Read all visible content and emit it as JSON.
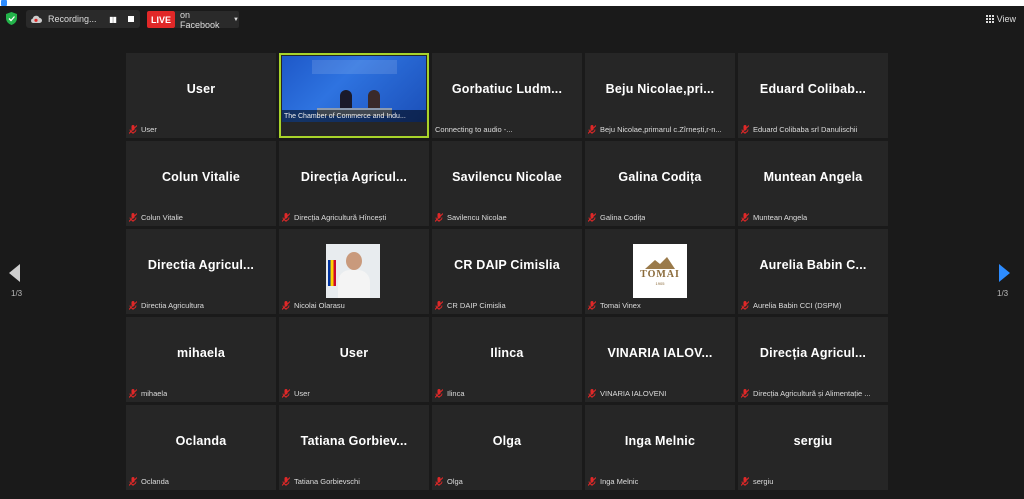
{
  "toolbar": {
    "recording_label": "Recording...",
    "live_label": "LIVE",
    "live_target": "on Facebook",
    "view_label": "View"
  },
  "pagination": {
    "left": "1/3",
    "right": "1/3"
  },
  "colors": {
    "live": "#e02828",
    "active_border": "#a8d42a",
    "accent": "#2d8cff"
  },
  "tiles": [
    {
      "name": "User",
      "label": "User"
    },
    {
      "name": "",
      "label": "",
      "caption": "The Chamber of Commerce and Indu..."
    },
    {
      "name": "Gorbatiuc Ludm...",
      "label": "Connecting to audio -..."
    },
    {
      "name": "Beju Nicolae,pri...",
      "label": "Beju Nicolae,primarul c.Zîrnești,r-n..."
    },
    {
      "name": "Eduard Colibab...",
      "label": "Eduard Colibaba srl Danulischii"
    },
    {
      "name": "Colun Vitalie",
      "label": "Colun Vitalie"
    },
    {
      "name": "Direcția Agricul...",
      "label": "Direcția Agricultură Hîncești"
    },
    {
      "name": "Savilencu Nicolae",
      "label": "Savilencu Nicolae"
    },
    {
      "name": "Galina Codița",
      "label": "Galina Codița"
    },
    {
      "name": "Muntean Angela",
      "label": "Muntean Angela"
    },
    {
      "name": "Directia Agricul...",
      "label": "Directia Agricultura"
    },
    {
      "name": "",
      "label": "Nicolai Olarasu"
    },
    {
      "name": "CR DAIP Cimislia",
      "label": "CR DAIP Cimislia"
    },
    {
      "name": "",
      "label": "Tomai Vinex",
      "logo_text": "TOMAI",
      "logo_year": "1905"
    },
    {
      "name": "Aurelia Babin C...",
      "label": "Aurelia Babin CCI (DSPM)"
    },
    {
      "name": "mihaela",
      "label": "mihaela"
    },
    {
      "name": "User",
      "label": "User"
    },
    {
      "name": "Ilinca",
      "label": "Ilinca"
    },
    {
      "name": "VINARIA IALOV...",
      "label": "VINARIA IALOVENI"
    },
    {
      "name": "Direcția Agricul...",
      "label": "Direcția Agricultură și Alimentație ..."
    },
    {
      "name": "Oclanda",
      "label": "Oclanda"
    },
    {
      "name": "Tatiana Gorbiev...",
      "label": "Tatiana Gorbievschi"
    },
    {
      "name": "Olga",
      "label": "Olga"
    },
    {
      "name": "Inga Melnic",
      "label": "Inga Melnic"
    },
    {
      "name": "sergiu",
      "label": "sergiu"
    }
  ]
}
